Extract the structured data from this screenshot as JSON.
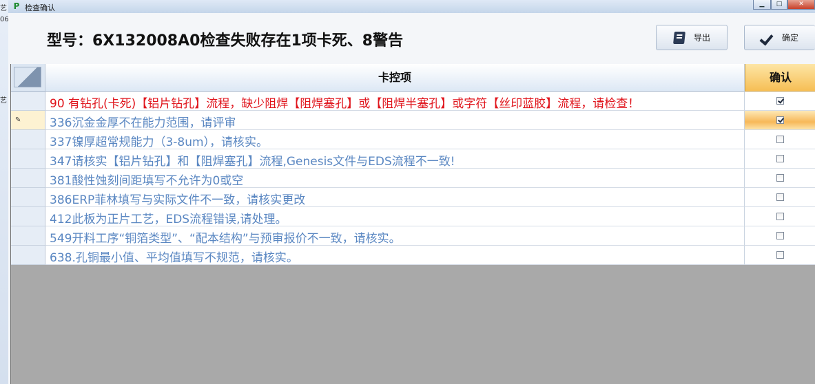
{
  "window": {
    "title": "检查确认"
  },
  "background_app": {
    "side_chars": [
      "艺",
      "06",
      "艺"
    ]
  },
  "header": {
    "headline": "型号：6X132008A0检查失败存在1项卡死、8警告",
    "export_label": "导出",
    "confirm_label": "确定"
  },
  "grid": {
    "columns": [
      "卡控项",
      "确认"
    ],
    "rows": [
      {
        "text": "90 有钻孔(卡死)【铝片钻孔】流程，缺少阻焊【阻焊塞孔】或【阻焊半塞孔】或字符【丝印蓝胶】流程，请检查！",
        "severity": "error",
        "checked": true
      },
      {
        "text": "336沉金金厚不在能力范围，请评审",
        "severity": "warning",
        "checked": true
      },
      {
        "text": "337镍厚超常规能力（3-8um），请核实。",
        "severity": "warning",
        "checked": false
      },
      {
        "text": "347请核实【铝片钻孔】和【阻焊塞孔】流程,Genesis文件与EDS流程不一致!",
        "severity": "warning",
        "checked": false
      },
      {
        "text": "381酸性蚀刻间距填写不允许为0或空",
        "severity": "warning",
        "checked": false
      },
      {
        "text": "386ERP菲林填写与实际文件不一致，请核实更改",
        "severity": "warning",
        "checked": false
      },
      {
        "text": "412此板为正片工艺，EDS流程错误,请处理。",
        "severity": "warning",
        "checked": false
      },
      {
        "text": "549开料工序“铜箔类型”、“配本结构”与预审报价不一致，请核实。",
        "severity": "warning",
        "checked": false
      },
      {
        "text": "638.孔铜最小值、平均值填写不规范，请核实。",
        "severity": "warning",
        "checked": false
      }
    ],
    "selected_row": 1
  },
  "colors": {
    "error_text": "#e0151c",
    "warning_text": "#5a87c2",
    "confirm_header": "#f6bf55",
    "empty_area": "#a9a9a9"
  },
  "icons": {
    "app": "app-logo-icon",
    "export": "book-icon",
    "confirm": "checkmark-icon",
    "edit_row": "pencil-icon"
  }
}
